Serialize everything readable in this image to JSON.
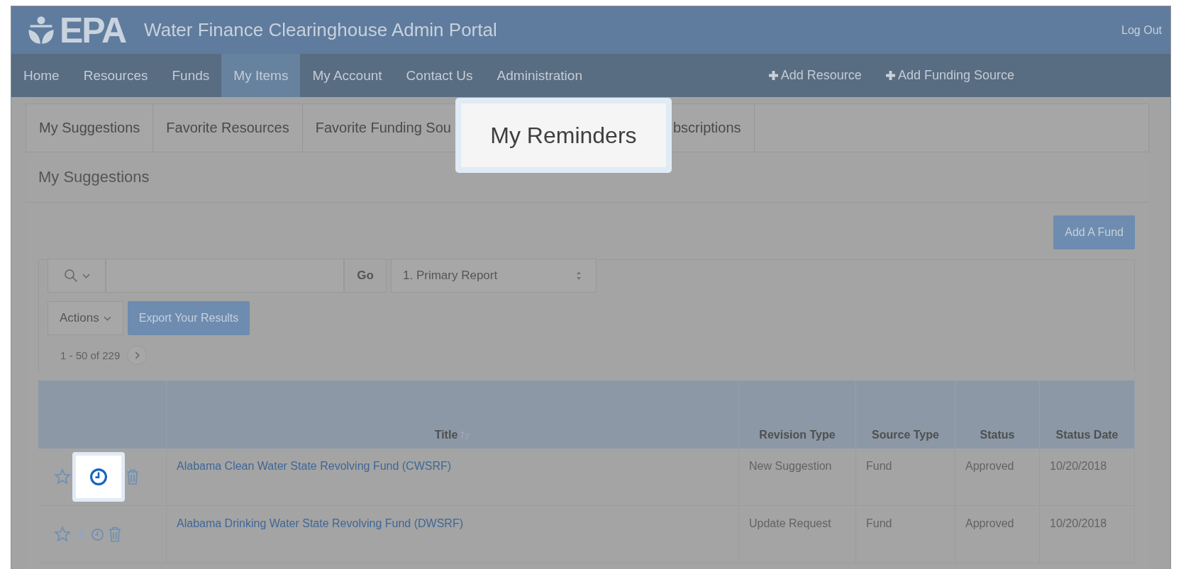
{
  "header": {
    "logo": "EPA",
    "title": "Water Finance Clearinghouse Admin Portal",
    "logout": "Log Out"
  },
  "nav": {
    "items": [
      {
        "label": "Home",
        "selected": false
      },
      {
        "label": "Resources",
        "selected": false
      },
      {
        "label": "Funds",
        "selected": false
      },
      {
        "label": "My Items",
        "selected": true
      },
      {
        "label": "My Account",
        "selected": false
      },
      {
        "label": "Contact Us",
        "selected": false
      },
      {
        "label": "Administration",
        "selected": false
      }
    ],
    "actions": [
      "Add Resource",
      "Add Funding Source"
    ]
  },
  "subtabs": [
    {
      "label": "My Suggestions",
      "highlighted": false
    },
    {
      "label": "Favorite Resources",
      "highlighted": false
    },
    {
      "label": "Favorite Funding Sou",
      "highlighted": false
    },
    {
      "label": "My Reminders",
      "highlighted": true
    },
    {
      "label": "bscriptions",
      "highlighted": false
    }
  ],
  "section_title": "My Suggestions",
  "add_button": "Add A Fund",
  "toolbar": {
    "go": "Go",
    "report": "1. Primary Report",
    "actions": "Actions",
    "export": "Export Your Results",
    "pagination": "1 - 50 of 229"
  },
  "table": {
    "columns": [
      "Title",
      "Revision Type",
      "Source Type",
      "Status",
      "Status Date"
    ],
    "rows": [
      {
        "actions": [
          {
            "kind": "star",
            "highlighted": false
          },
          {
            "kind": "reminder",
            "highlighted": true
          },
          {
            "kind": "delete",
            "highlighted": false
          }
        ],
        "title": "Alabama Clean Water State Revolving Fund (CWSRF)",
        "revision_type": "New Suggestion",
        "source_type": "Fund",
        "status": "Approved",
        "status_date": "10/20/2018"
      },
      {
        "actions": [
          {
            "kind": "star",
            "highlighted": false
          },
          {
            "kind": "edit",
            "highlighted": false
          },
          {
            "kind": "reminder",
            "highlighted": false
          },
          {
            "kind": "delete",
            "highlighted": false
          }
        ],
        "title": "Alabama Drinking Water State Revolving Fund (DWSRF)",
        "revision_type": "Update Request",
        "source_type": "Fund",
        "status": "Approved",
        "status_date": "10/20/2018"
      }
    ]
  }
}
